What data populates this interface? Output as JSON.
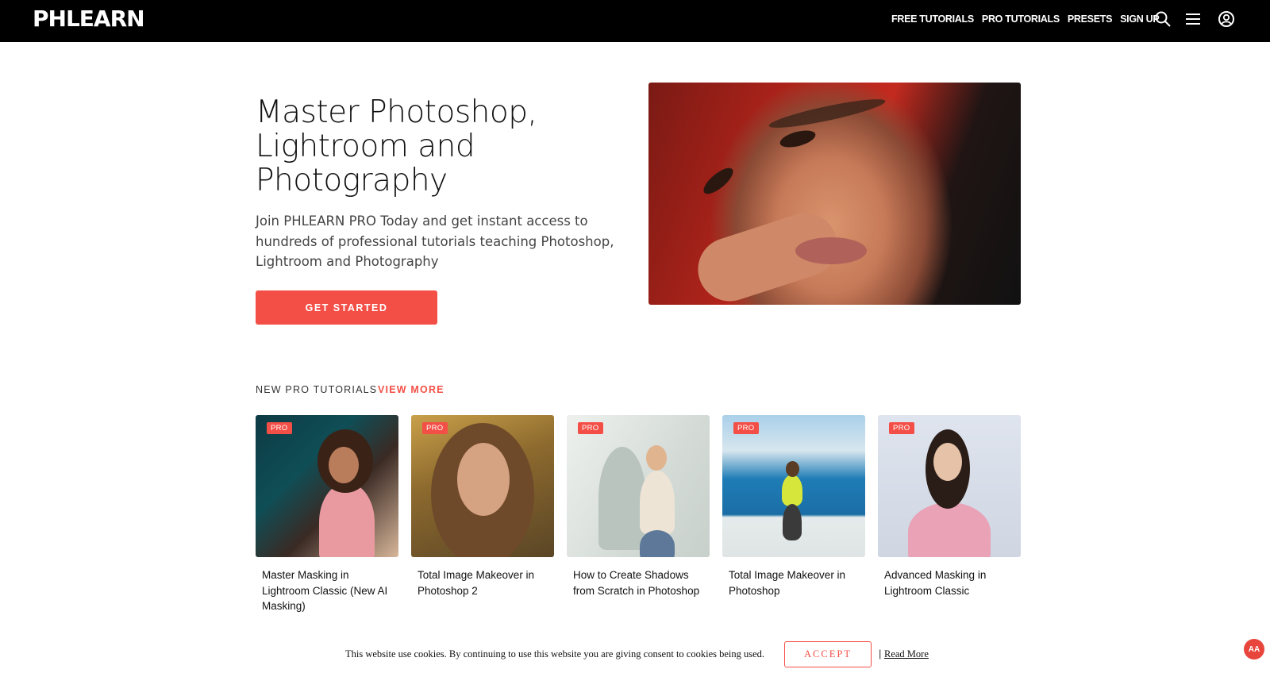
{
  "header": {
    "logo": "PHLEARN",
    "nav": [
      "FREE TUTORIALS",
      "PRO TUTORIALS",
      "PRESETS",
      "SIGN UP"
    ],
    "icons": [
      "search-icon",
      "menu-icon",
      "account-icon"
    ]
  },
  "hero": {
    "title": "Master Photoshop, Lightroom and Photography",
    "subtitle": "Join PHLEARN PRO Today and get instant access to hundreds of professional tutorials teaching Photoshop, Lightroom and Photography",
    "cta": "GET STARTED"
  },
  "section": {
    "label": "NEW PRO TUTORIALS",
    "link": "VIEW MORE"
  },
  "cards": [
    {
      "badge": "PRO",
      "title": "Master Masking in Lightroom Classic (New AI Masking)"
    },
    {
      "badge": "PRO",
      "title": "Total Image Makeover in Photoshop 2"
    },
    {
      "badge": "PRO",
      "title": "How to Create Shadows from Scratch in Photoshop"
    },
    {
      "badge": "PRO",
      "title": "Total Image Makeover in Photoshop"
    },
    {
      "badge": "PRO",
      "title": "Advanced Masking in Lightroom Classic"
    }
  ],
  "cookie": {
    "text": "This website use cookies. By continuing to use this website you are giving consent to cookies being used.",
    "accept": "ACCEPT",
    "separator": "|",
    "read_more": "Read More"
  },
  "accessibility": {
    "label": "AA"
  },
  "colors": {
    "accent": "#f44f47",
    "header_bg": "#000000"
  }
}
